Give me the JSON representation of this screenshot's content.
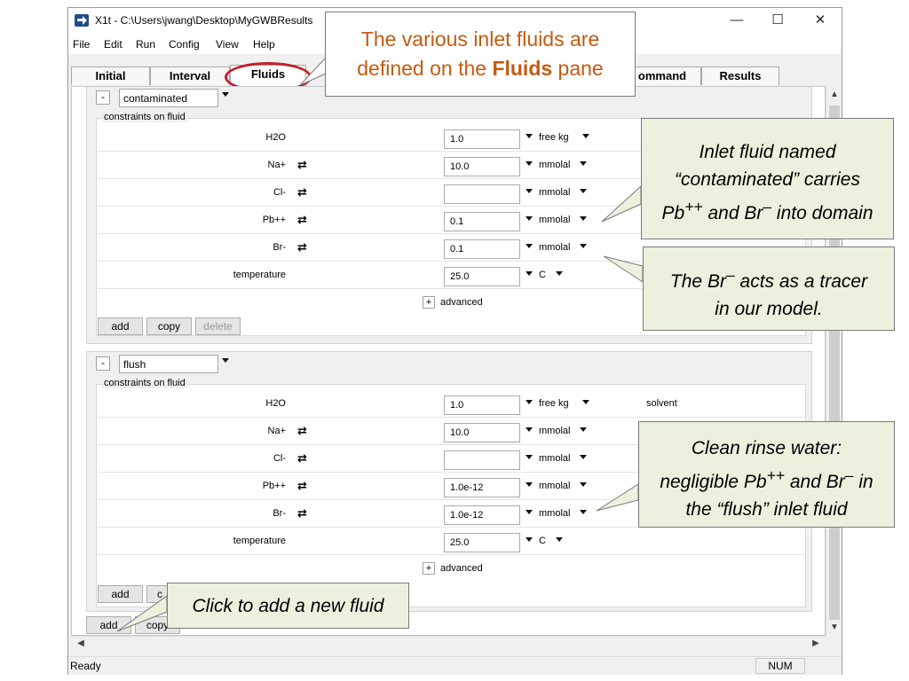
{
  "window": {
    "title": "X1t - C:\\Users\\jwang\\Desktop\\MyGWBResults",
    "controls": {
      "minimize": "—",
      "maximize": "☐",
      "close": "✕"
    }
  },
  "menu": [
    "File",
    "Edit",
    "Run",
    "Config",
    "View",
    "Help"
  ],
  "tabs": [
    {
      "label": "Initial",
      "active": false
    },
    {
      "label": "Interval",
      "active": false
    },
    {
      "label": "Fluids",
      "active": true
    },
    {
      "label": "ommand",
      "active": false
    },
    {
      "label": "Results",
      "active": false
    }
  ],
  "fluids": [
    {
      "name": "contaminated",
      "collapse": "-",
      "group_title": "constraints on fluid",
      "rows": [
        {
          "label": "H2O",
          "value": "1.0",
          "unit": "free kg",
          "swap": false,
          "extra": ""
        },
        {
          "label": "Na+",
          "value": "10.0",
          "unit": "mmolal",
          "swap": true,
          "extra": ""
        },
        {
          "label": "Cl-",
          "value": "",
          "unit": "mmolal",
          "swap": true,
          "extra": ""
        },
        {
          "label": "Pb++",
          "value": "0.1",
          "unit": "mmolal",
          "swap": true,
          "extra": ""
        },
        {
          "label": "Br-",
          "value": "0.1",
          "unit": "mmolal",
          "swap": true,
          "extra": ""
        },
        {
          "label": "temperature",
          "value": "25.0",
          "unit": "C",
          "swap": false,
          "extra": ""
        }
      ],
      "advanced": {
        "toggle": "+",
        "label": "advanced"
      },
      "buttons": {
        "add": "add",
        "copy": "copy",
        "delete": "delete"
      }
    },
    {
      "name": "flush",
      "collapse": "-",
      "group_title": "constraints on fluid",
      "rows": [
        {
          "label": "H2O",
          "value": "1.0",
          "unit": "free kg",
          "swap": false,
          "extra": "solvent"
        },
        {
          "label": "Na+",
          "value": "10.0",
          "unit": "mmolal",
          "swap": true,
          "extra": ""
        },
        {
          "label": "Cl-",
          "value": "",
          "unit": "mmolal",
          "swap": true,
          "extra": ""
        },
        {
          "label": "Pb++",
          "value": "1.0e-12",
          "unit": "mmolal",
          "swap": true,
          "extra": ""
        },
        {
          "label": "Br-",
          "value": "1.0e-12",
          "unit": "mmolal",
          "swap": true,
          "extra": ""
        },
        {
          "label": "temperature",
          "value": "25.0",
          "unit": "C",
          "swap": false,
          "extra": ""
        }
      ],
      "advanced": {
        "toggle": "+",
        "label": "advanced"
      },
      "buttons": {
        "add": "add",
        "copy": "c"
      }
    }
  ],
  "outer_buttons": {
    "add": "add",
    "copy": "copy"
  },
  "status": {
    "text": "Ready",
    "num": "NUM"
  },
  "callouts": {
    "fluids_pane": {
      "line1": "The various inlet fluids are",
      "line2_pre": "defined on the ",
      "line2_bold": "Fluids",
      "line2_post": " pane"
    },
    "contaminated": {
      "line1": "Inlet fluid named",
      "line2": "“contaminated” carries",
      "line3_a": "Pb",
      "line3_sup1": "++",
      "line3_b": " and Br",
      "line3_sup2": "–",
      "line3_c": " into domain"
    },
    "tracer": {
      "line1_a": "The Br",
      "line1_sup": "–",
      "line1_b": " acts as a tracer",
      "line2": "in our model."
    },
    "flush": {
      "line1": "Clean rinse water:",
      "line2_a": "negligible Pb",
      "line2_sup1": "++",
      "line2_b": " and Br",
      "line2_sup2": "–",
      "line2_c": " in",
      "line3": "the “flush” inlet fluid"
    },
    "add_fluid": {
      "text": "Click to add a new fluid"
    }
  },
  "colors": {
    "callout_fill": "#ebf1de",
    "callout_orange_text": "#c55a11",
    "tab_highlight": "#c0202a"
  }
}
